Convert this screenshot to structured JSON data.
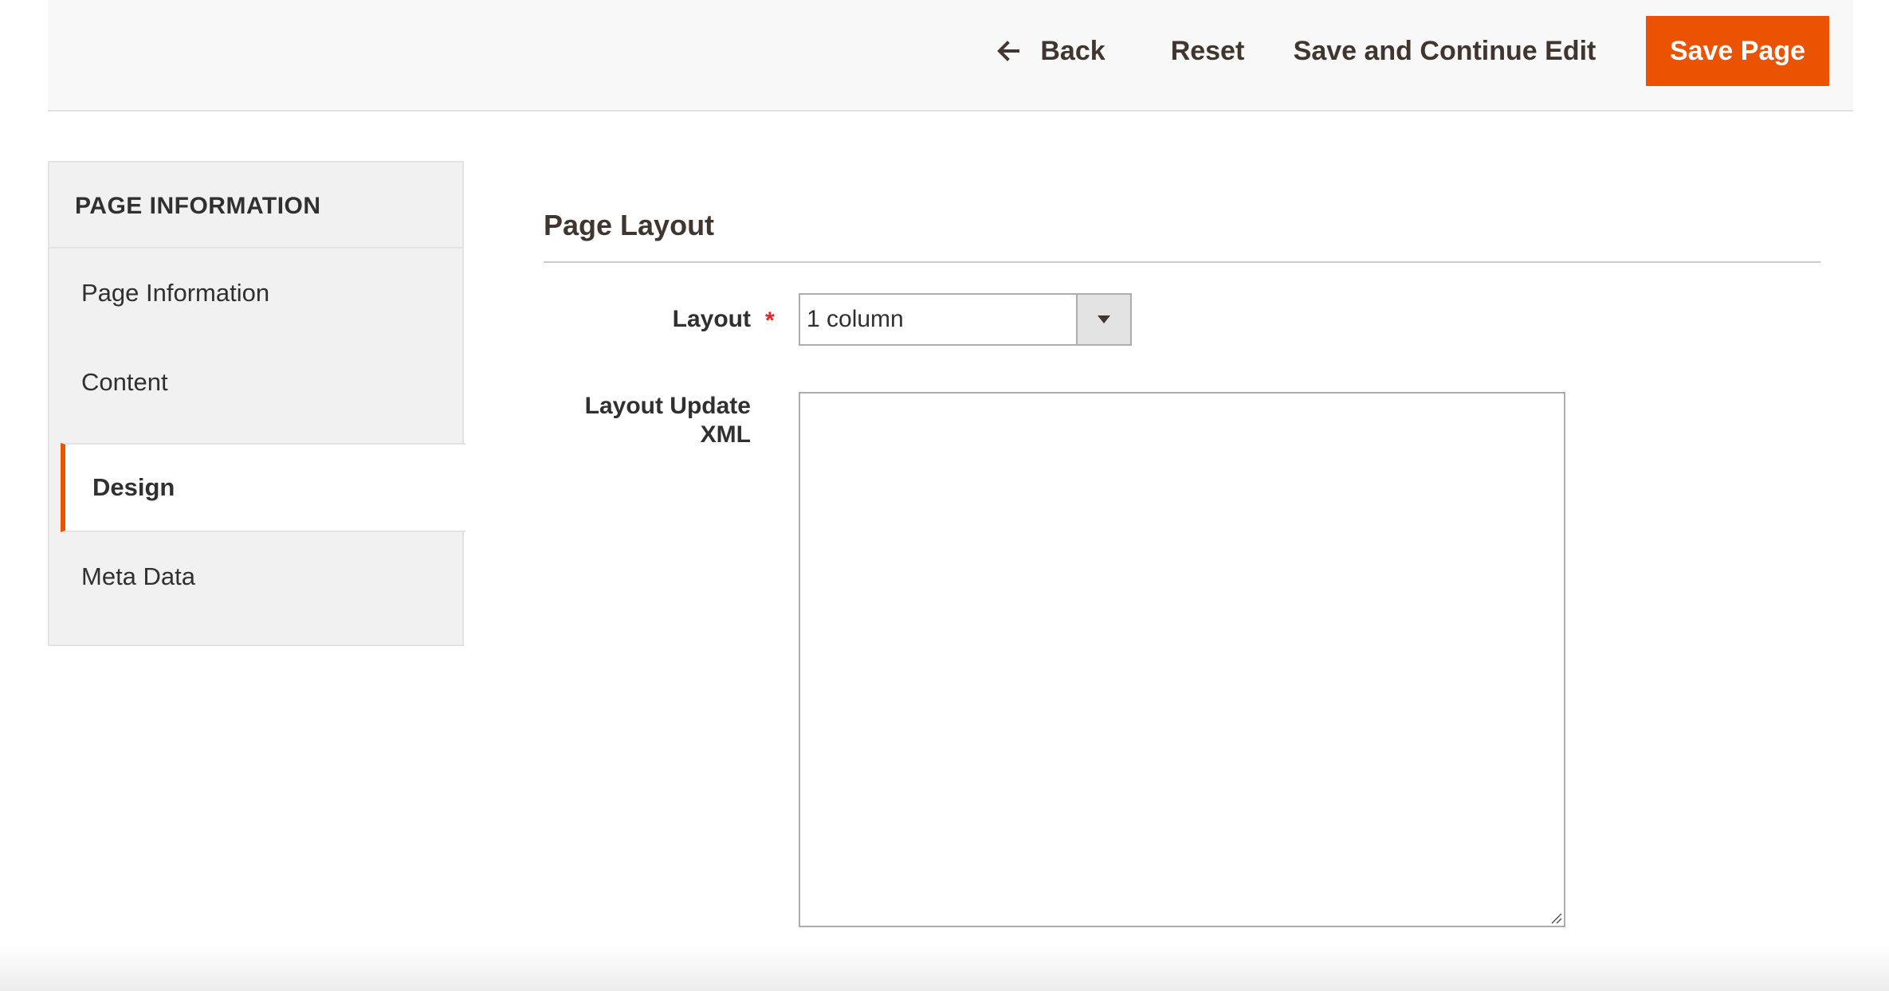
{
  "toolbar": {
    "back_label": "Back",
    "reset_label": "Reset",
    "save_continue_label": "Save and Continue Edit",
    "save_page_label": "Save Page",
    "back_icon": "arrow-left-icon",
    "accent_color": "#eb5202"
  },
  "sidebar": {
    "title": "PAGE INFORMATION",
    "items": [
      {
        "label": "Page Information",
        "active": false
      },
      {
        "label": "Content",
        "active": false
      },
      {
        "label": "Design",
        "active": true
      },
      {
        "label": "Meta Data",
        "active": false
      }
    ]
  },
  "main": {
    "section_title": "Page Layout",
    "layout_field": {
      "label": "Layout",
      "required_marker": "*",
      "value": "1 column",
      "toggle_icon": "chevron-down-icon"
    },
    "xml_field": {
      "label_line1": "Layout Update",
      "label_line2": "XML",
      "value": ""
    }
  }
}
